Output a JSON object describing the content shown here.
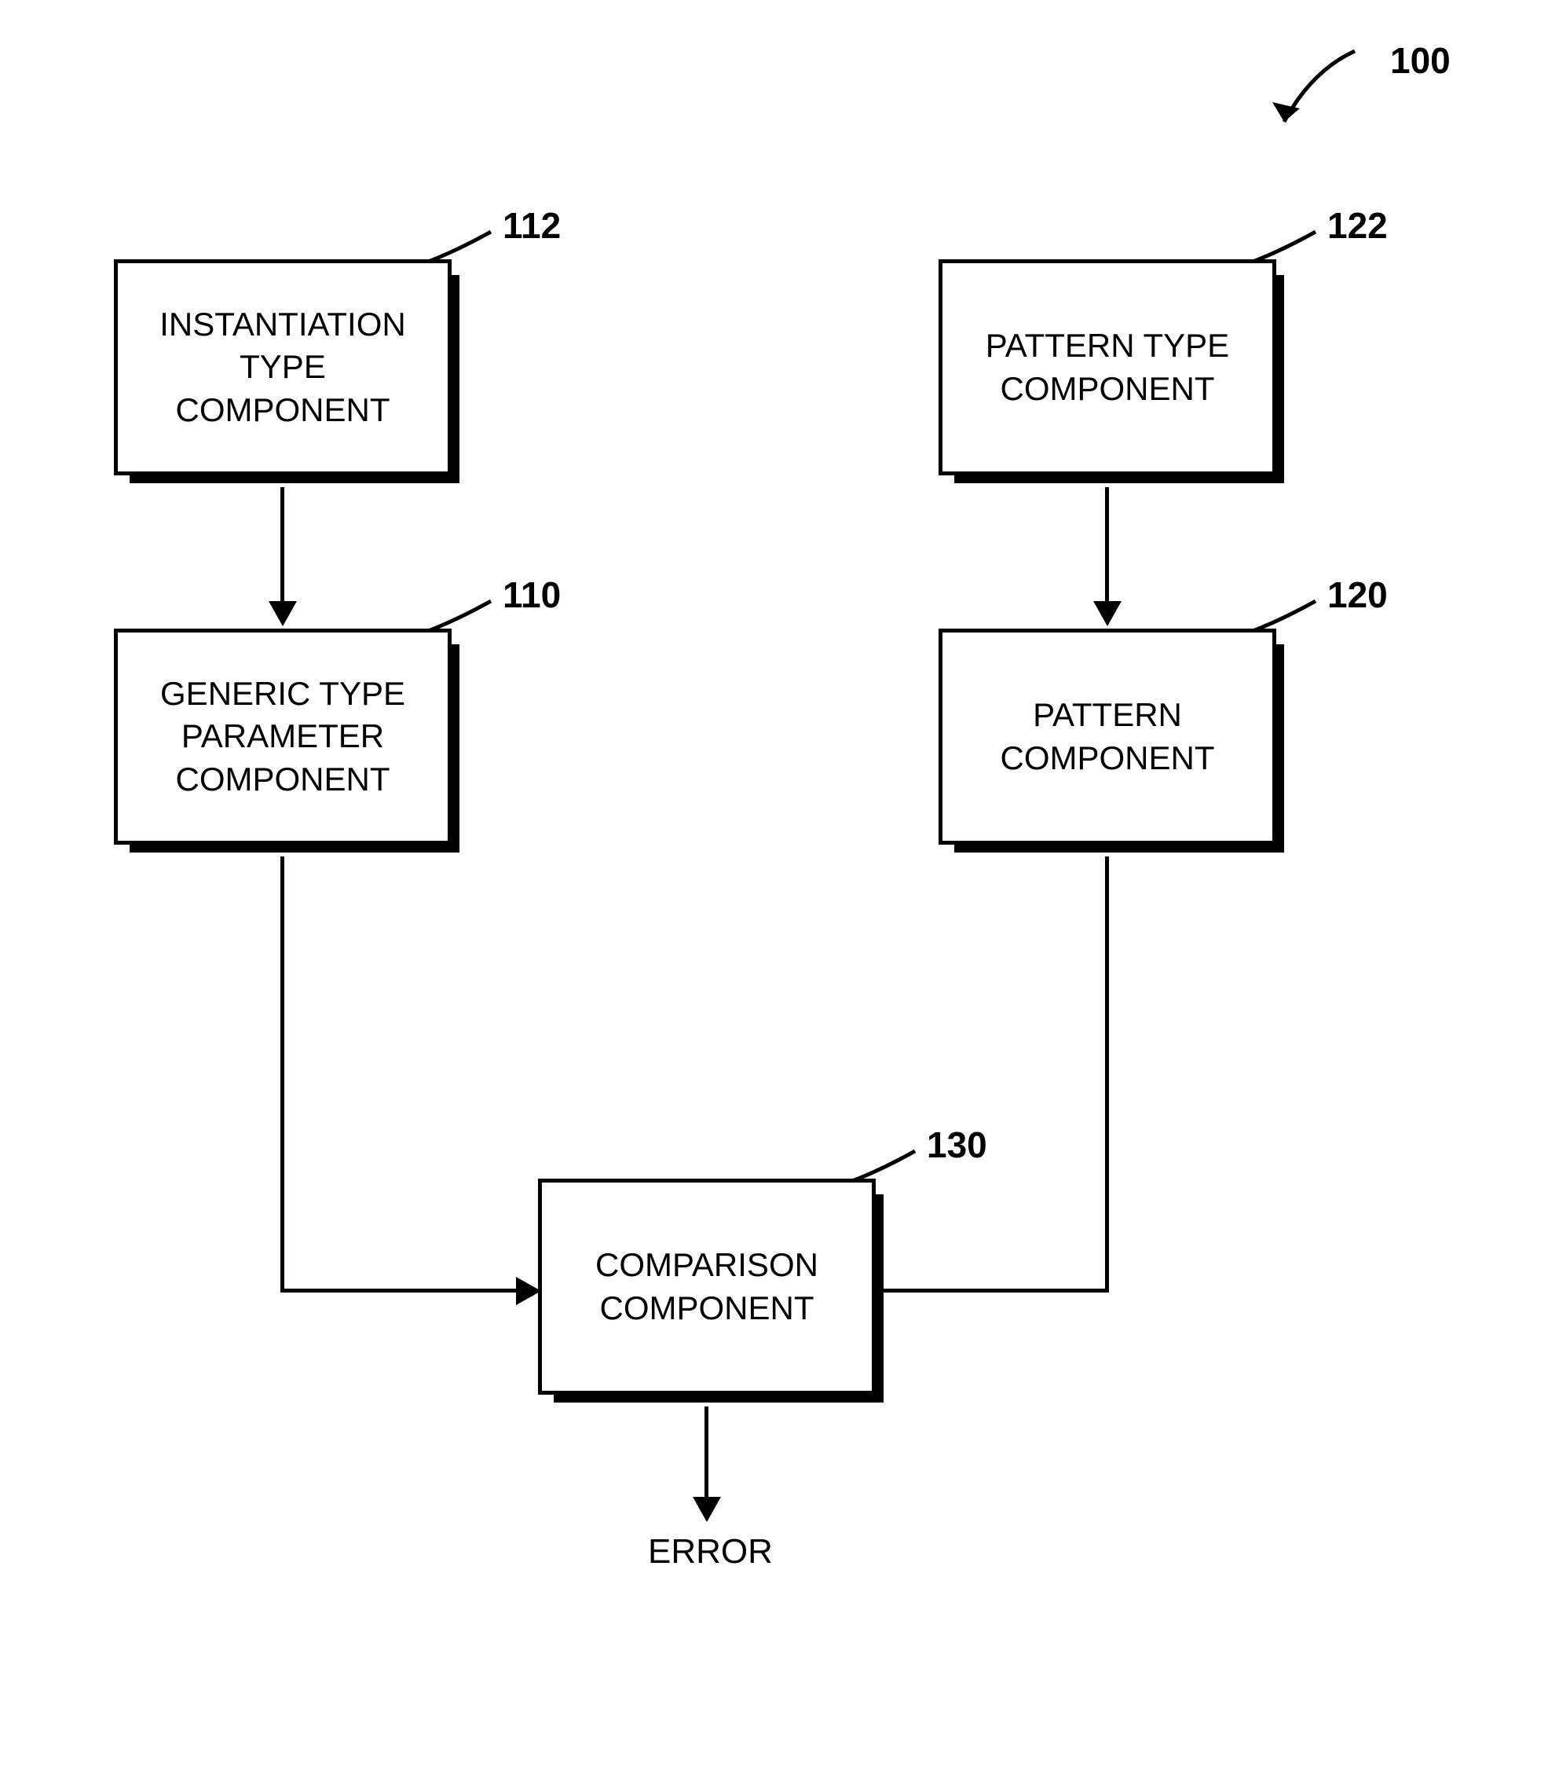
{
  "diagram": {
    "main_label": "100",
    "boxes": {
      "instantiation": {
        "label": "112",
        "text": "INSTANTIATION TYPE COMPONENT"
      },
      "pattern_type": {
        "label": "122",
        "text": "PATTERN TYPE COMPONENT"
      },
      "generic": {
        "label": "110",
        "text": "GENERIC TYPE PARAMETER COMPONENT"
      },
      "pattern": {
        "label": "120",
        "text": "PATTERN COMPONENT"
      },
      "comparison": {
        "label": "130",
        "text": "COMPARISON COMPONENT"
      }
    },
    "output": "ERROR"
  }
}
